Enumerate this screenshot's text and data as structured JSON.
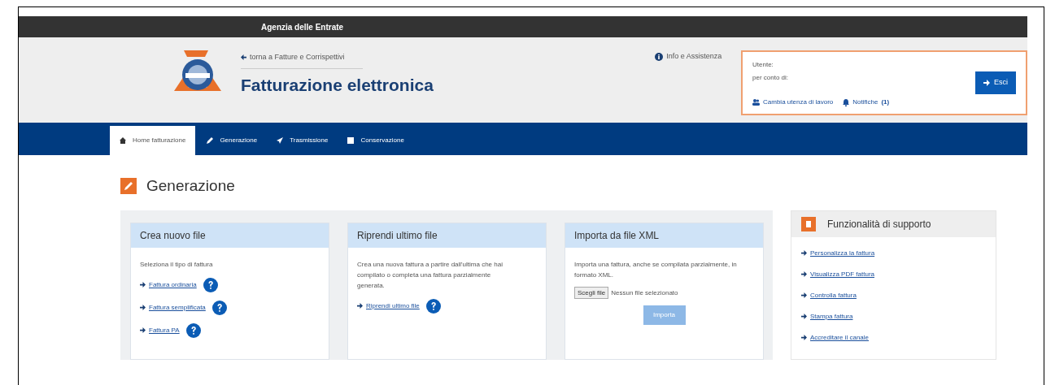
{
  "top_bar": {
    "title": "Agenzia delle Entrate"
  },
  "header": {
    "back_link": "torna a Fatture e Corrispettivi",
    "title": "Fatturazione elettronica",
    "info_link": "Info e Assistenza"
  },
  "user_box": {
    "user_label": "Utente:",
    "on_behalf_label": "per conto di:",
    "change_link": "Cambia utenza di lavoro",
    "notifications_link": "Notifiche",
    "notifications_count": "(1)",
    "logout_button": "Esci"
  },
  "nav": {
    "tabs": [
      {
        "label": "Home fatturazione",
        "selected": true
      },
      {
        "label": "Generazione",
        "selected": false
      },
      {
        "label": "Trasmissione",
        "selected": false
      },
      {
        "label": "Conservazione",
        "selected": false
      }
    ]
  },
  "page_title": "Generazione",
  "cards": [
    {
      "title": "Crea nuovo file",
      "text": "Seleziona il tipo di fattura",
      "links": [
        "Fattura ordinaria",
        "Fattura semplificata",
        "Fattura PA"
      ]
    },
    {
      "title": "Riprendi ultimo file",
      "text": "Crea una nuova fattura a partire dall'ultima che hai compilato o completa una fattura parzialmente generata.",
      "links": [
        "Riprendi ultimo file"
      ]
    },
    {
      "title": "Importa da file XML",
      "text": "Importa una fattura, anche se compilata parzialmente, in formato XML.",
      "file_button": "Scegli file",
      "file_status": "Nessun file selezionato",
      "import_button": {
        "label": "Importa",
        "disabled": true
      }
    }
  ],
  "support": {
    "title": "Funzionalità di supporto",
    "links": [
      "Personalizza la fattura",
      "Visualizza PDF fattura",
      "Controlla fattura",
      "Stampa fattura",
      "Accreditare il canale"
    ]
  }
}
